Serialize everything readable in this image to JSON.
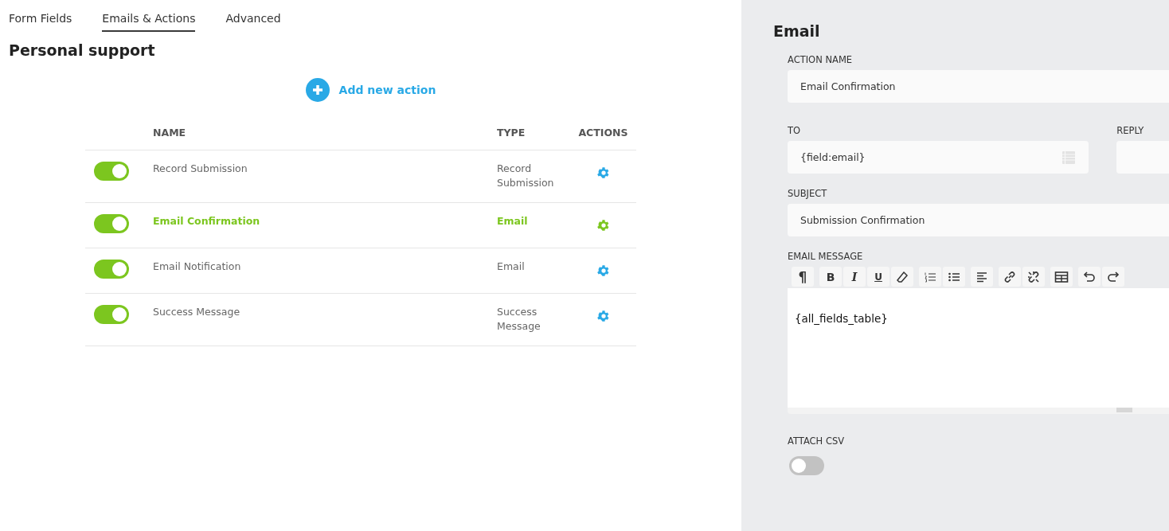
{
  "tabs": [
    {
      "label": "Form Fields",
      "selected": false
    },
    {
      "label": "Emails & Actions",
      "selected": true
    },
    {
      "label": "Advanced",
      "selected": false
    }
  ],
  "form_title": "Personal support",
  "add_action": {
    "label": "Add new action"
  },
  "table": {
    "columns": [
      "NAME",
      "TYPE",
      "ACTIONS"
    ],
    "rows": [
      {
        "enabled": true,
        "name": "Record Submission",
        "type": "Record Submission",
        "selected": false
      },
      {
        "enabled": true,
        "name": "Email Confirmation",
        "type": "Email",
        "selected": true
      },
      {
        "enabled": true,
        "name": "Email Notification",
        "type": "Email",
        "selected": false
      },
      {
        "enabled": true,
        "name": "Success Message",
        "type": "Success Message",
        "selected": false
      }
    ]
  },
  "editor": {
    "title": "Email",
    "action_name": {
      "label": "ACTION NAME",
      "value": "Email Confirmation"
    },
    "to": {
      "label": "TO",
      "value": "{field:email}"
    },
    "reply_to": {
      "label": "REPLY"
    },
    "subject": {
      "label": "SUBJECT",
      "value": "Submission Confirmation"
    },
    "message": {
      "label": "EMAIL MESSAGE",
      "body": "{all_fields_table}",
      "toolbar": [
        [
          {
            "kind": "paragraph",
            "label": "¶"
          }
        ],
        [
          {
            "kind": "bold",
            "label": "B"
          },
          {
            "kind": "italic",
            "label": "I"
          },
          {
            "kind": "underline",
            "label": "U"
          },
          {
            "kind": "eraser"
          }
        ],
        [
          {
            "kind": "ordered-list"
          },
          {
            "kind": "bullet-list"
          }
        ],
        [
          {
            "kind": "align-left"
          }
        ],
        [
          {
            "kind": "link"
          },
          {
            "kind": "unlink"
          }
        ],
        [
          {
            "kind": "table"
          }
        ],
        [
          {
            "kind": "undo"
          },
          {
            "kind": "redo"
          }
        ]
      ]
    },
    "attach_csv": {
      "label": "ATTACH CSV",
      "on": false
    }
  }
}
